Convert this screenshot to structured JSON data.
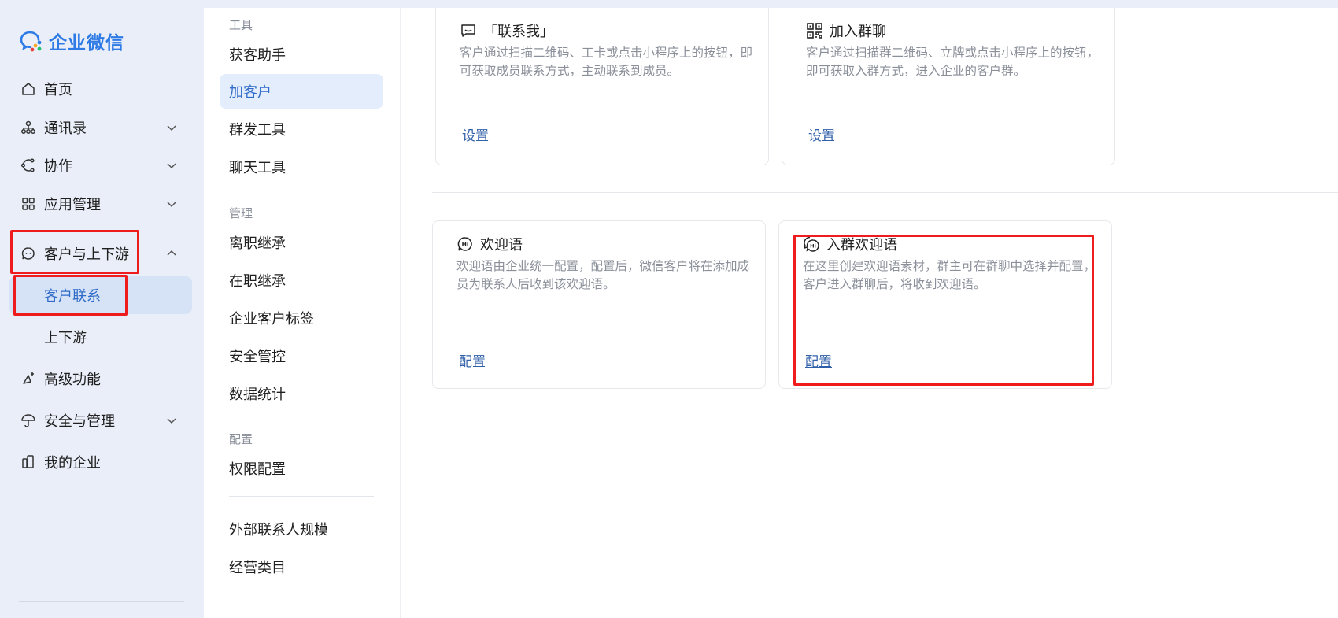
{
  "app": {
    "brand": "企业微信",
    "brand_color": "#2f7be5",
    "highlight_color": "#ee1c1c"
  },
  "sidebar": {
    "items": [
      {
        "label": "首页",
        "icon": "home-icon"
      },
      {
        "label": "通讯录",
        "icon": "org-chart-icon",
        "expandable": true
      },
      {
        "label": "协作",
        "icon": "collaboration-icon",
        "expandable": true
      },
      {
        "label": "应用管理",
        "icon": "grid-apps-icon",
        "expandable": true
      },
      {
        "label": "客户与上下游",
        "icon": "customer-face-icon",
        "expanded": true
      },
      {
        "label": "高级功能",
        "icon": "sparkle-icon"
      },
      {
        "label": "安全与管理",
        "icon": "umbrella-icon",
        "expandable": true
      },
      {
        "label": "我的企业",
        "icon": "building-icon"
      }
    ],
    "subitems": [
      {
        "label": "客户联系",
        "active": true
      },
      {
        "label": "上下游",
        "active": false
      }
    ]
  },
  "submenu": {
    "groups": [
      {
        "title": "工具",
        "items": [
          "获客助手",
          "加客户",
          "群发工具",
          "聊天工具"
        ]
      },
      {
        "title": "管理",
        "items": [
          "离职继承",
          "在职继承",
          "企业客户标签",
          "安全管控",
          "数据统计"
        ]
      },
      {
        "title": "配置",
        "items": [
          "权限配置"
        ]
      }
    ],
    "extra_items": [
      "外部联系人规模",
      "经营类目"
    ],
    "active_item": "加客户"
  },
  "cards": {
    "contact_me": {
      "title": "「联系我」",
      "icon": "chat-bubble-icon",
      "desc": "客户通过扫描二维码、工卡或点击小程序上的按钮，即可获取成员联系方式，主动联系到成员。",
      "link": "设置"
    },
    "join_group": {
      "title": "加入群聊",
      "icon": "qr-code-icon",
      "desc": "客户通过扫描群二维码、立牌或点击小程序上的按钮，即可获取入群方式，进入企业的客户群。",
      "link": "设置"
    },
    "welcome": {
      "title": "欢迎语",
      "icon": "hi-bubble-icon",
      "desc": "欢迎语由企业统一配置，配置后，微信客户将在添加成员为联系人后收到该欢迎语。",
      "link": "配置"
    },
    "group_welcome": {
      "title": "入群欢迎语",
      "icon": "group-hi-bubble-icon",
      "desc": "在这里创建欢迎语素材，群主可在群聊中选择并配置，客户进入群聊后，将收到欢迎语。",
      "link": "配置"
    }
  }
}
